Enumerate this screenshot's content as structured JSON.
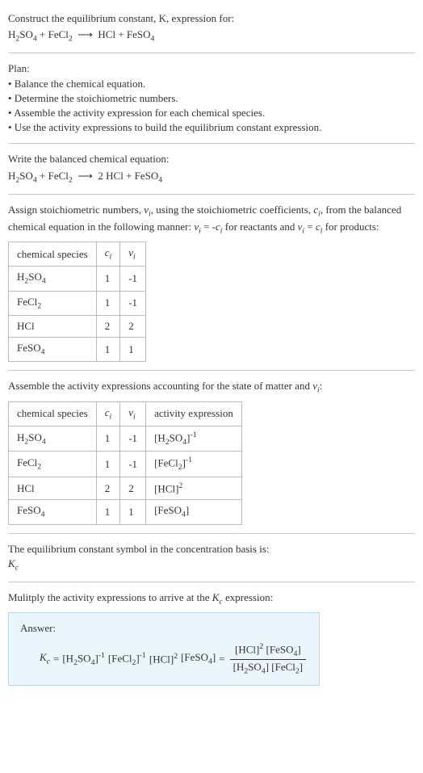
{
  "header": {
    "line1": "Construct the equilibrium constant, K, expression for:"
  },
  "plan": {
    "title": "Plan:",
    "b1": "• Balance the chemical equation.",
    "b2": "• Determine the stoichiometric numbers.",
    "b3": "• Assemble the activity expression for each chemical species.",
    "b4": "• Use the activity expressions to build the equilibrium constant expression."
  },
  "balanced_label": "Write the balanced chemical equation:",
  "assign_text": "Assign stoichiometric numbers, ν_i, using the stoichiometric coefficients, c_i, from the balanced chemical equation in the following manner: ν_i = -c_i for reactants and ν_i = c_i for products:",
  "table1": {
    "h1": "chemical species",
    "h2": "c_i",
    "h3": "ν_i",
    "rows": [
      {
        "sp": "H2SO4",
        "c": "1",
        "v": "-1"
      },
      {
        "sp": "FeCl2",
        "c": "1",
        "v": "-1"
      },
      {
        "sp": "HCl",
        "c": "2",
        "v": "2"
      },
      {
        "sp": "FeSO4",
        "c": "1",
        "v": "1"
      }
    ]
  },
  "assemble_text": "Assemble the activity expressions accounting for the state of matter and ν_i:",
  "table2": {
    "h1": "chemical species",
    "h2": "c_i",
    "h3": "ν_i",
    "h4": "activity expression"
  },
  "eqconst_line1": "The equilibrium constant symbol in the concentration basis is:",
  "eqconst_line2": "K_c",
  "mult_line": "Mulitply the activity expressions to arrive at the K_c expression:",
  "answer_label": "Answer:",
  "chart_data": {
    "type": "table",
    "title": "Equilibrium constant derivation for H2SO4 + FeCl2 → 2 HCl + FeSO4",
    "reaction_unbalanced": "H2SO4 + FeCl2 → HCl + FeSO4",
    "reaction_balanced": "H2SO4 + FeCl2 → 2 HCl + FeSO4",
    "species": [
      {
        "name": "H2SO4",
        "c_i": 1,
        "nu_i": -1,
        "activity_expression": "[H2SO4]^-1"
      },
      {
        "name": "FeCl2",
        "c_i": 1,
        "nu_i": -1,
        "activity_expression": "[FeCl2]^-1"
      },
      {
        "name": "HCl",
        "c_i": 2,
        "nu_i": 2,
        "activity_expression": "[HCl]^2"
      },
      {
        "name": "FeSO4",
        "c_i": 1,
        "nu_i": 1,
        "activity_expression": "[FeSO4]"
      }
    ],
    "Kc_expression_product": "[H2SO4]^-1 [FeCl2]^-1 [HCl]^2 [FeSO4]",
    "Kc_expression_fraction": "([HCl]^2 [FeSO4]) / ([H2SO4] [FeCl2])"
  }
}
